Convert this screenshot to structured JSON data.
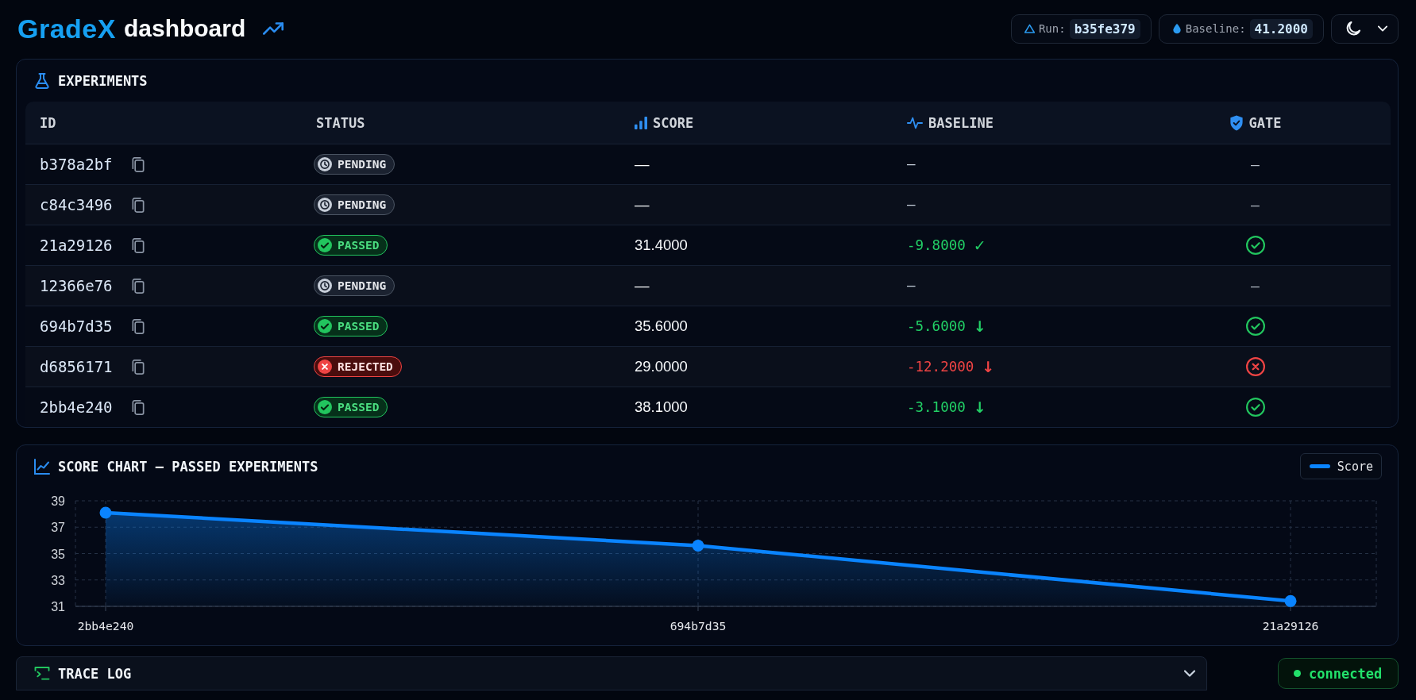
{
  "header": {
    "brand": "GradeX",
    "title": "dashboard",
    "run": {
      "label": "Run:",
      "value": "b35fe379"
    },
    "baseline": {
      "label": "Baseline:",
      "value": "41.2000"
    },
    "theme_toggle": {
      "dark": true
    }
  },
  "experiments": {
    "title": "EXPERIMENTS",
    "columns": [
      "ID",
      "STATUS",
      "SCORE",
      "BASELINE",
      "GATE"
    ],
    "rows": [
      {
        "id": "b378a2bf",
        "status": {
          "label": "PENDING",
          "kind": "pending"
        },
        "score": "—",
        "baseline": "—",
        "gate": {
          "kind": "none",
          "text": "—"
        }
      },
      {
        "id": "c84c3496",
        "status": {
          "label": "PENDING",
          "kind": "pending"
        },
        "score": "—",
        "baseline": "—",
        "gate": {
          "kind": "none",
          "text": "—"
        }
      },
      {
        "id": "21a29126",
        "status": {
          "label": "PASSED",
          "kind": "passed"
        },
        "score": "31.4000",
        "baseline": "-9.8000",
        "trend": "✓",
        "gate": {
          "kind": "pass"
        }
      },
      {
        "id": "12366e76",
        "status": {
          "label": "PENDING",
          "kind": "pending"
        },
        "score": "—",
        "baseline": "—",
        "gate": {
          "kind": "none",
          "text": "—"
        }
      },
      {
        "id": "694b7d35",
        "status": {
          "label": "PASSED",
          "kind": "passed"
        },
        "score": "35.6000",
        "baseline": "-5.6000",
        "trend": "↓",
        "gate": {
          "kind": "pass"
        }
      },
      {
        "id": "d6856171",
        "status": {
          "label": "REJECTED",
          "kind": "rejected"
        },
        "score": "29.0000",
        "baseline": "-12.2000",
        "trend": "↓",
        "gate": {
          "kind": "fail"
        }
      },
      {
        "id": "2bb4e240",
        "status": {
          "label": "PASSED",
          "kind": "passed"
        },
        "score": "38.1000",
        "baseline": "-3.1000",
        "trend": "↓",
        "gate": {
          "kind": "pass"
        }
      }
    ]
  },
  "chart": {
    "chart_data": {
      "type": "area",
      "title": "SCORE CHART — PASSED EXPERIMENTS",
      "categories": [
        "2bb4e240",
        "694b7d35",
        "21a29126"
      ],
      "series": [
        {
          "name": "Score",
          "color": "#0a84ff",
          "values": [
            38.1,
            35.6,
            31.4
          ]
        }
      ],
      "ylim": [
        31,
        39
      ],
      "yticks": [
        31,
        33,
        35,
        37,
        39
      ],
      "grid": true
    }
  },
  "trace_log": {
    "title": "TRACE LOG",
    "expanded": false
  },
  "connection": {
    "label": "connected",
    "online": true
  }
}
